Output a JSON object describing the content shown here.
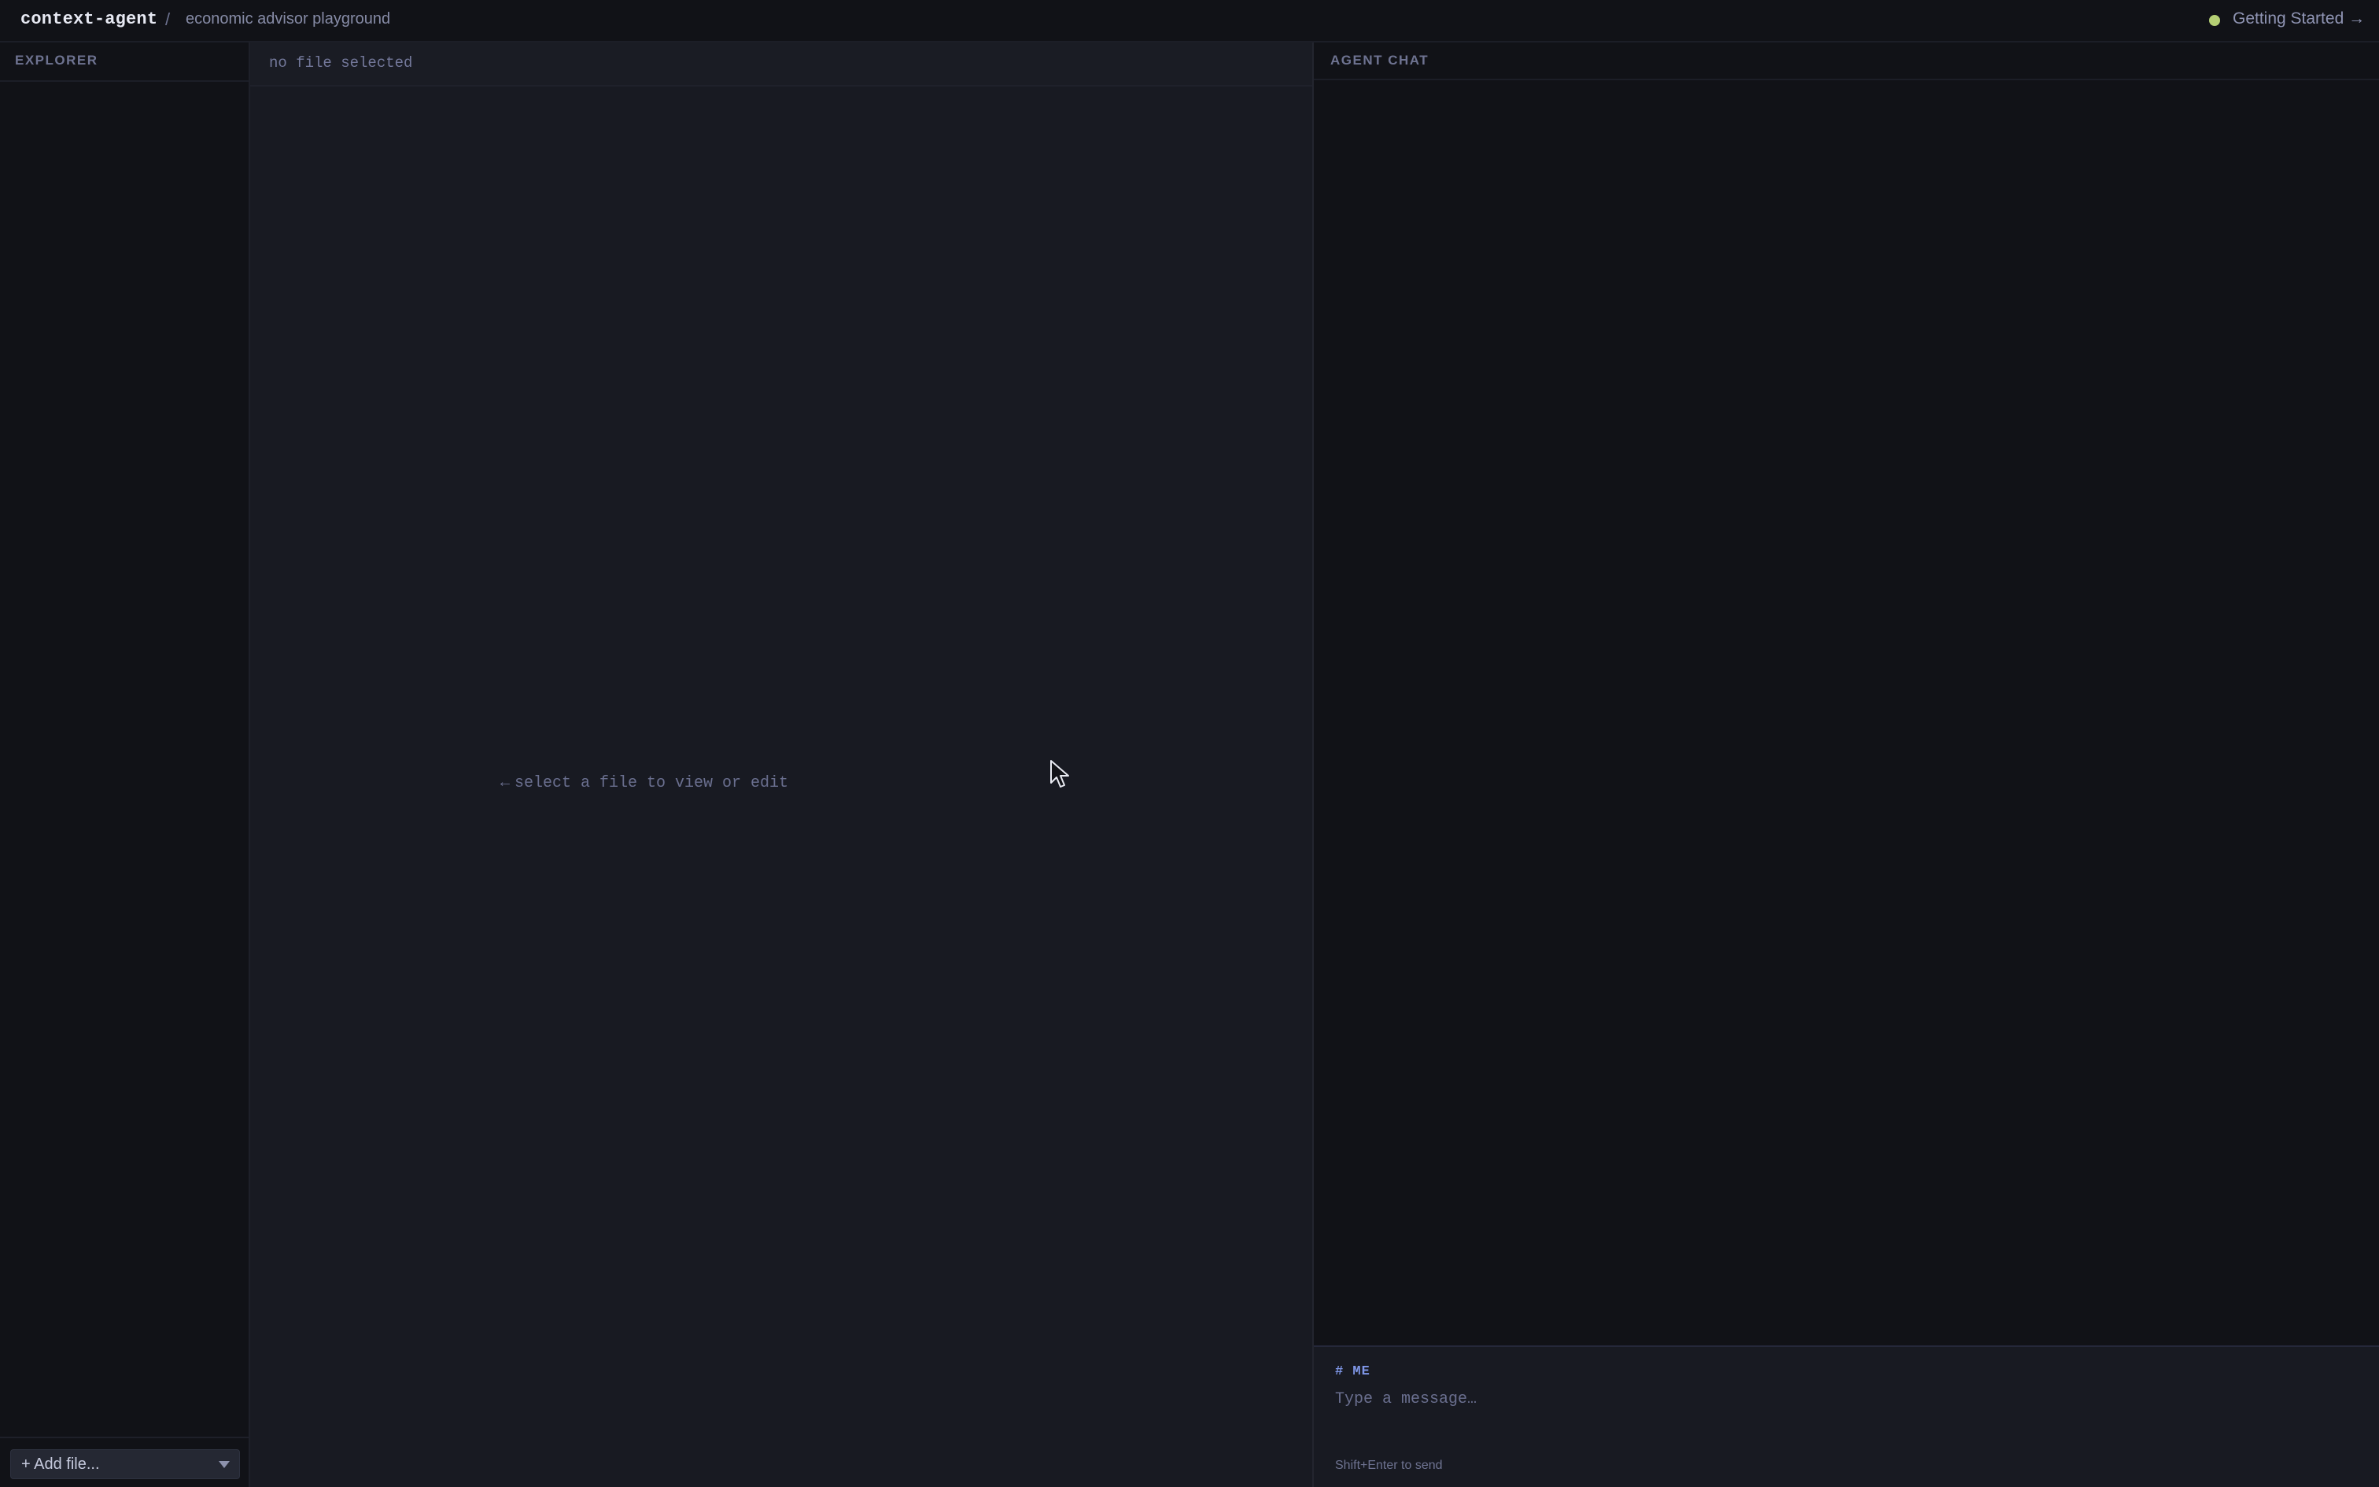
{
  "topbar": {
    "brand": "context-agent",
    "separator": "/",
    "project": "economic advisor playground",
    "status_color": "#b5cf74",
    "getting_started": "Getting Started →"
  },
  "explorer": {
    "title": "EXPLORER",
    "add_file_label": "+ Add file..."
  },
  "editor": {
    "header": "no file selected",
    "empty_arrow": "←",
    "empty_message": "select a file to view or edit"
  },
  "chat": {
    "title": "AGENT CHAT",
    "composer_role": "# ME",
    "input_placeholder": "Type a message…",
    "hint": "Shift+Enter to send"
  },
  "colors": {
    "accent": "#7f97e8",
    "background": "#111217",
    "panel": "#181a22"
  }
}
